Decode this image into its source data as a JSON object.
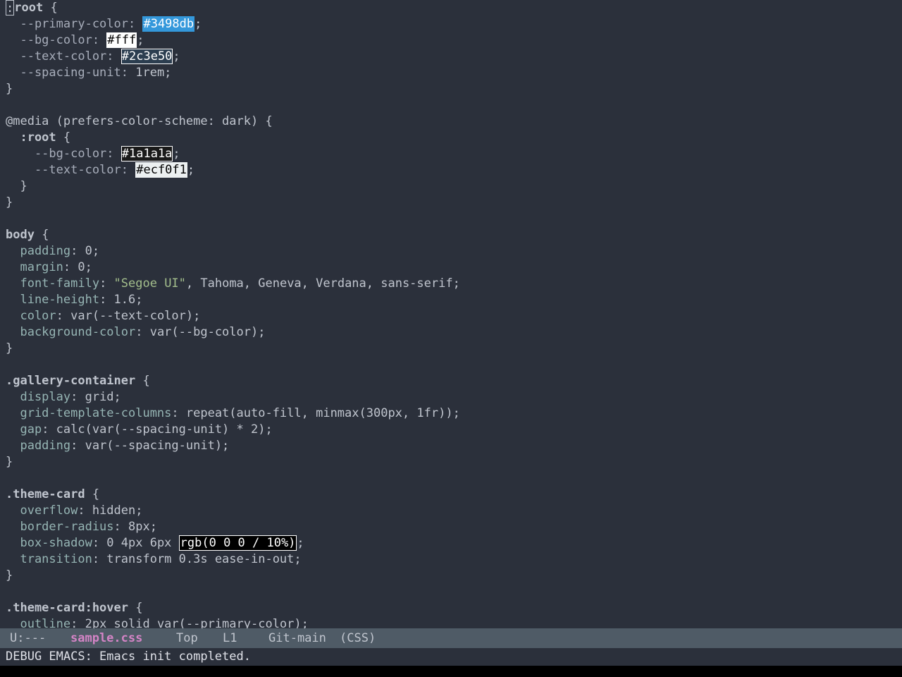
{
  "buffer": {
    "lines": {
      "l1_sel": "root",
      "l1_colon": ":",
      "l1_brace": " {",
      "l2_prop": "  --primary-color: ",
      "l2_val": "#3498db",
      "l2_end": ";",
      "l3_prop": "  --bg-color: ",
      "l3_val": "#fff",
      "l3_end": ";",
      "l4_prop": "  --text-color: ",
      "l4_val": "#2c3e50",
      "l4_end": ";",
      "l5_prop": "  --spacing-unit: ",
      "l5_val": "1rem;",
      "l6": "}",
      "l8_at": "@media",
      "l8_rest": " (prefers-color-scheme: dark) {",
      "l9_sel": "  :root",
      "l9_brace": " {",
      "l10_prop": "    --bg-color: ",
      "l10_val": "#1a1a1a",
      "l10_end": ";",
      "l11_prop": "    --text-color: ",
      "l11_val": "#ecf0f1",
      "l11_end": ";",
      "l12": "  }",
      "l13": "}",
      "l15_sel": "body",
      "l15_brace": " {",
      "l16_prop": "  padding",
      "l16_val": ": 0;",
      "l17_prop": "  margin",
      "l17_val": ": 0;",
      "l18_prop": "  font-family",
      "l18_val1": ": ",
      "l18_str": "\"Segoe UI\"",
      "l18_val2": ", Tahoma, Geneva, Verdana, sans-serif;",
      "l19_prop": "  line-height",
      "l19_val": ": 1.6;",
      "l20_prop": "  color",
      "l20_val": ": var(--text-color);",
      "l21_prop": "  background-color",
      "l21_val": ": var(--bg-color);",
      "l22": "}",
      "l24_sel": ".gallery-container",
      "l24_brace": " {",
      "l25_prop": "  display",
      "l25_val": ": grid;",
      "l26_prop": "  grid-template-columns",
      "l26_val": ": repeat(auto-fill, minmax(300px, 1fr));",
      "l27_prop": "  gap",
      "l27_val": ": calc(var(--spacing-unit) * 2);",
      "l28_prop": "  padding",
      "l28_val": ": var(--spacing-unit);",
      "l29": "}",
      "l31_sel": ".theme-card",
      "l31_brace": " {",
      "l32_prop": "  overflow",
      "l32_val": ": hidden;",
      "l33_prop": "  border-radius",
      "l33_val": ": 8px;",
      "l34_prop": "  box-shadow",
      "l34_val": ": 0 4px 6px ",
      "l34_swatch": "rgb(0 0 0 / 10%)",
      "l34_end": ";",
      "l35_prop": "  transition",
      "l35_val": ": transform 0.3s ease-in-out;",
      "l36": "}",
      "l38_sel": ".theme-card:hover",
      "l38_brace": " {",
      "l39_prop": "  outline",
      "l39_val": ": 2px solid var(--primary-color);"
    }
  },
  "modeline": {
    "status": "U:---",
    "buffer_name": "sample.css",
    "position": "Top",
    "line": "L1",
    "vc": "Git-main",
    "mode": "(CSS)"
  },
  "echo_area": {
    "message": "DEBUG EMACS: Emacs init completed."
  },
  "colors": {
    "background": "#2b303b",
    "modeline_bg": "#4f5b66",
    "buffer_name": "#d484c6",
    "property": "#96b5b4",
    "string": "#a3be8c",
    "swatch_primary": "#3498db"
  }
}
